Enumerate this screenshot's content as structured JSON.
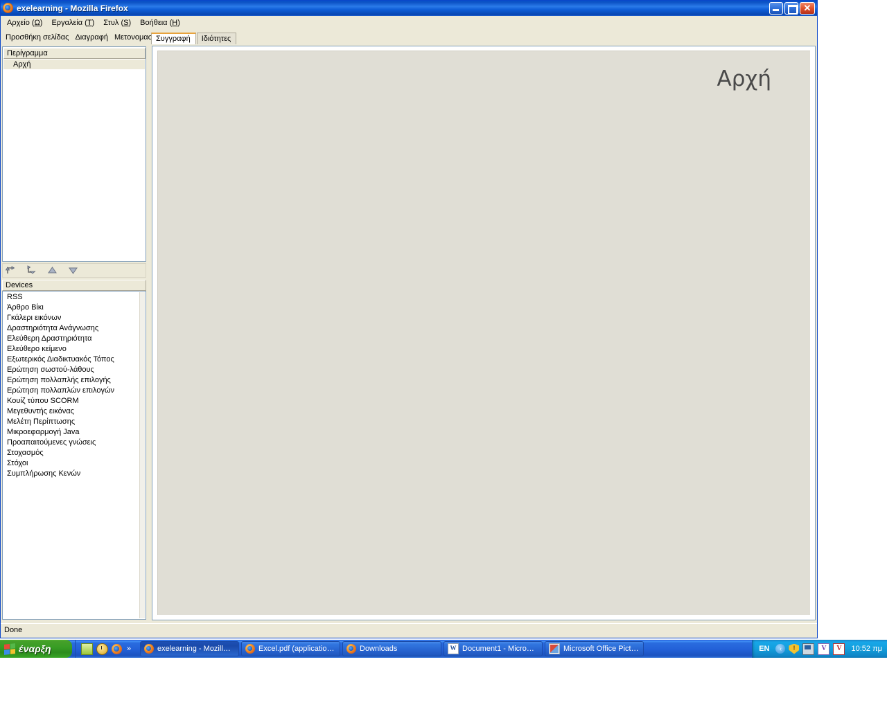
{
  "window": {
    "title": "exelearning - Mozilla Firefox",
    "app_icon": "firefox-icon",
    "buttons": {
      "minimize": "minimize-button",
      "restore": "restore-button",
      "close": "close-button"
    }
  },
  "menubar": {
    "items": [
      {
        "label": "Αρχείο (",
        "accel": "Ω",
        "tail": ")"
      },
      {
        "label": "Εργαλεία (",
        "accel": "T",
        "tail": ")"
      },
      {
        "label": "Στυλ (",
        "accel": "S",
        "tail": ")"
      },
      {
        "label": "Βοήθεια (",
        "accel": "H",
        "tail": ")"
      }
    ]
  },
  "toolbar": {
    "buttons": [
      "Προσθήκη σελίδας",
      "Διαγραφή",
      "Μετονομασία"
    ]
  },
  "tabs": [
    {
      "label": "Συγγραφή",
      "active": true
    },
    {
      "label": "Ιδιότητες",
      "active": false
    }
  ],
  "outline": {
    "header": "Περίγραμμα",
    "items": [
      {
        "label": "Αρχή",
        "selected": true
      }
    ],
    "toolbar_icons": [
      "promote-icon",
      "demote-icon",
      "move-up-icon",
      "move-down-icon"
    ]
  },
  "devices": {
    "header": "Devices",
    "items": [
      "RSS",
      "Άρθρο Βίκι",
      "Γκάλερι εικόνων",
      "Δραστηριότητα Ανάγνωσης",
      "Ελεύθερη Δραστηριότητα",
      "Ελεύθερο κείμενο",
      "Εξωτερικός Διαδικτυακός Τόπος",
      "Ερώτηση σωστού-λάθους",
      "Ερώτηση πολλαπλής επιλογής",
      "Ερώτηση πολλαπλών επιλογών",
      "Κουίζ τύπου SCORM",
      "Μεγεθυντής εικόνας",
      "Μελέτη Περίπτωσης",
      "Μικροεφαρμογή Java",
      "Προαπαιτούμενες γνώσεις",
      "Στοχασμός",
      "Στόχοι",
      "Συμπλήρωσης Κενών"
    ]
  },
  "content": {
    "page_heading": "Αρχή"
  },
  "statusbar": {
    "text": "Done"
  },
  "taskbar": {
    "start_label": "έναρξη",
    "quicklaunch": [
      "show-desktop-icon",
      "clock-icon",
      "firefox-icon",
      "more-chevron-icon"
    ],
    "tasks": [
      {
        "label": "exelearning - Mozilla ...",
        "icon": "firefox-icon",
        "active": true
      },
      {
        "label": "Excel.pdf (application...",
        "icon": "firefox-icon",
        "active": false
      },
      {
        "label": "Downloads",
        "icon": "firefox-icon",
        "active": false
      },
      {
        "label": "Document1 - Microsof...",
        "icon": "word-icon",
        "active": false
      },
      {
        "label": "Microsoft Office Pictu...",
        "icon": "picture-manager-icon",
        "active": false
      }
    ],
    "tray": {
      "language": "EN",
      "icons": [
        "tray-expand-icon",
        "security-shield-icon",
        "network-monitor-icon",
        "app-v-icon",
        "antivirus-icon"
      ],
      "clock": "10:52 πμ"
    }
  },
  "colors": {
    "titlebar_blue": "#0a4fc2",
    "face": "#ece9d8",
    "content_grey": "#e0ded5",
    "taskbar_blue": "#245edb",
    "start_green": "#389d24",
    "tab_active_accent": "#e8a33d"
  }
}
